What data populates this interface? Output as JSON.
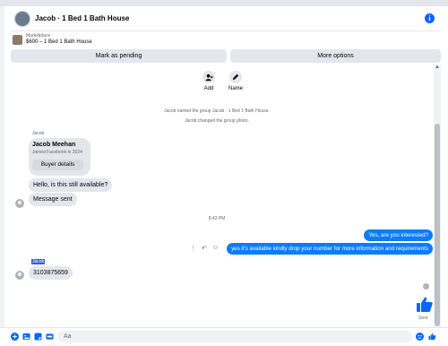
{
  "header": {
    "title": "Jacob · 1 Bed 1 Bath House"
  },
  "listing": {
    "category": "Marketplace",
    "price_title": "$600 – 1 Bed 1 Bath House"
  },
  "buttons": {
    "mark_pending": "Mark as pending",
    "more_options": "More options"
  },
  "actions": {
    "add": "Add",
    "name": "Name"
  },
  "system_messages": [
    "Jacob named the group Jacob · 1 Bed 1 Bath House.",
    "Jacob changed the group photo."
  ],
  "buyer_card": {
    "sender": "Jacob",
    "name": "Jacob Meehan",
    "joined": "Joined Facebook in 2024",
    "button": "Buyer details"
  },
  "messages_in": [
    "Hello, is this still available?",
    "Message sent"
  ],
  "timestamp": "8:43 PM",
  "messages_out": [
    "Yes, are you interested?",
    "yes it's available kindly drop your number for more information and requirements"
  ],
  "reply": {
    "sender": "Jacob",
    "text": "3103875659"
  },
  "status": {
    "sent": "Sent"
  },
  "composer": {
    "placeholder": "Aa"
  },
  "colors": {
    "accent": "#0866ff",
    "outgoing_bubble": "#0a7cff",
    "incoming_bubble": "#e4e6eb"
  }
}
